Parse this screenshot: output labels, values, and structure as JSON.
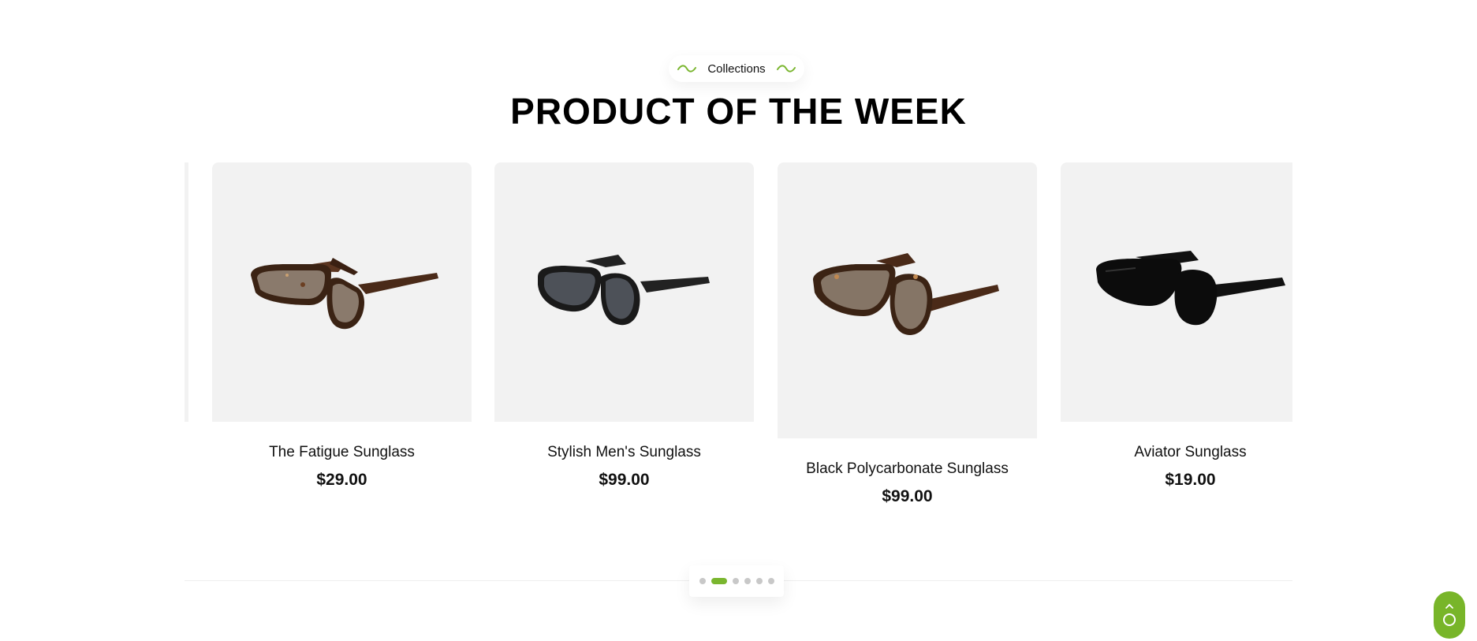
{
  "section": {
    "subtitle": "Collections",
    "title": "PRODUCT OF THE WEEK",
    "accent_color": "#7ab62f"
  },
  "products": [
    {
      "name": "The Fatigue Sunglass",
      "price": "$29.00",
      "icon": "tortoise-wayfarer-sunglasses"
    },
    {
      "name": "Stylish Men's Sunglass",
      "price": "$99.00",
      "icon": "black-round-sunglasses"
    },
    {
      "name": "Black Polycarbonate Sunglass",
      "price": "$99.00",
      "icon": "tortoise-cat-eye-sunglasses"
    },
    {
      "name": "Aviator Sunglass",
      "price": "$19.00",
      "icon": "black-wayfarer-sunglasses"
    }
  ],
  "pagination": {
    "total": 6,
    "active": 2
  },
  "scroll_top": {
    "icon": "chevron-up-icon",
    "progress_icon": "circle-progress-icon"
  }
}
